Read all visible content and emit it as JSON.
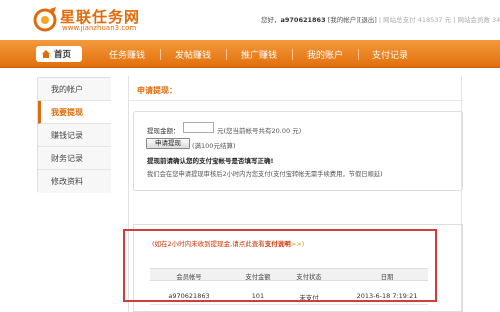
{
  "header": {
    "logo_title": "星联任务网",
    "logo_url": "www.jianzhuan3.com",
    "greeting": "您好，",
    "user_id": "a970621863",
    "my_account": "[我的帐户]",
    "logout": "[退出]",
    "paid_label": "| 网站总支付 418537 元",
    "members_label": "| 网站会员数 34"
  },
  "nav": {
    "home": "首页",
    "items": [
      "任务赚钱",
      "发帖赚钱",
      "推广赚钱",
      "我的账户",
      "支付记录"
    ]
  },
  "sidebar": {
    "items": [
      "我的帐户",
      "我要提现",
      "赚钱记录",
      "财务记录",
      "修改资料"
    ],
    "active_index": 1
  },
  "main": {
    "title": "申请提现：",
    "amount_label": "提现金额：",
    "amount_value": "",
    "amount_hint": "元(您当前帐号共有20.00 元)",
    "apply_button": "申请提现",
    "fee_text": "(满100元结算)",
    "confirm_text": "提现前请确认您的支付宝帐号是否填写正确!",
    "process_note": "我们会在您申请提现审核后2小时内为您支付(支付宝转帐无需手续费用，节假日顺延)"
  },
  "records": {
    "title_prefix": "(如在2小时内未收到提现金,请点此查看",
    "title_link": "支付说明",
    "title_suffix": ">>)",
    "columns": [
      "会员帐号",
      "支付金额",
      "支付状态",
      "日期"
    ],
    "rows": [
      [
        "a970621863",
        "101",
        "未支付",
        "2013-6-18 7:19:21"
      ]
    ]
  },
  "colors": {
    "brand_orange": "#e4710e",
    "annotation_red": "#d43c3c"
  }
}
